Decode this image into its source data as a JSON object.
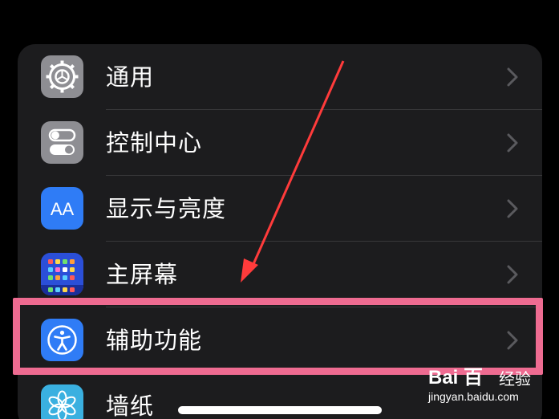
{
  "settings": {
    "items": [
      {
        "label": "通用",
        "icon": "gear-icon",
        "color": "#8e8e93"
      },
      {
        "label": "控制中心",
        "icon": "toggles-icon",
        "color": "#8e8e93"
      },
      {
        "label": "显示与亮度",
        "icon": "text-size-icon",
        "icon_text": "AA",
        "color": "#2f7cf6"
      },
      {
        "label": "主屏幕",
        "icon": "home-screen-grid-icon",
        "color": "#2b4fd8"
      },
      {
        "label": "辅助功能",
        "icon": "accessibility-icon",
        "color": "#2f7cf6"
      },
      {
        "label": "墙纸",
        "icon": "wallpaper-flower-icon",
        "color": "#3ab0e0"
      }
    ]
  },
  "annotation": {
    "highlight_color": "#ee6b91",
    "arrow_color": "#ff3b3b"
  },
  "watermark": {
    "logo": "Bai 百",
    "name": "经验",
    "url": "jingyan.baidu.com"
  }
}
